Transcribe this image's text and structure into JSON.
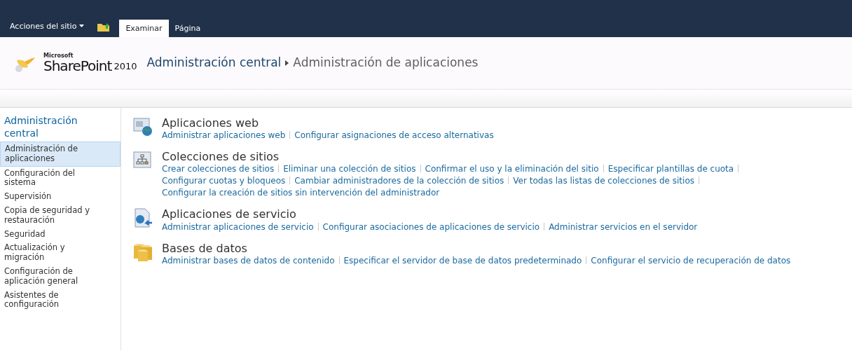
{
  "ribbon": {
    "site_actions": "Acciones del sitio",
    "tabs": [
      {
        "label": "Examinar",
        "selected": true
      },
      {
        "label": "Página",
        "selected": false
      }
    ]
  },
  "header": {
    "logo_small": "Microsoft",
    "logo_product": "SharePoint",
    "logo_version": "2010",
    "breadcrumb": [
      "Administración central",
      "Administración de aplicaciones"
    ]
  },
  "sidebar": {
    "title": "Administración central",
    "items": [
      {
        "label": "Administración de aplicaciones",
        "selected": true
      },
      {
        "label": "Configuración del sistema",
        "selected": false
      },
      {
        "label": "Supervisión",
        "selected": false
      },
      {
        "label": "Copia de seguridad y restauración",
        "selected": false
      },
      {
        "label": "Seguridad",
        "selected": false
      },
      {
        "label": "Actualización y migración",
        "selected": false
      },
      {
        "label": "Configuración de aplicación general",
        "selected": false
      },
      {
        "label": "Asistentes de configuración",
        "selected": false
      }
    ]
  },
  "sections": [
    {
      "kind": "web",
      "title": "Aplicaciones web",
      "link_rows": [
        [
          "Administrar aplicaciones web",
          "Configurar asignaciones de acceso alternativas"
        ]
      ]
    },
    {
      "kind": "sites",
      "title": "Colecciones de sitios",
      "link_rows": [
        [
          "Crear colecciones de sitios",
          "Eliminar una colección de sitios",
          "Confirmar el uso y la eliminación del sitio",
          "Especificar plantillas de cuota"
        ],
        [
          "Configurar cuotas y bloqueos",
          "Cambiar administradores de la colección de sitios",
          "Ver todas las listas de colecciones de sitios"
        ],
        [
          "Configurar la creación de sitios sin intervención del administrador"
        ]
      ]
    },
    {
      "kind": "service",
      "title": "Aplicaciones de servicio",
      "link_rows": [
        [
          "Administrar aplicaciones de servicio",
          "Configurar asociaciones de aplicaciones de servicio",
          "Administrar servicios en el servidor"
        ]
      ]
    },
    {
      "kind": "database",
      "title": "Bases de datos",
      "link_rows": [
        [
          "Administrar bases de datos de contenido",
          "Especificar el servidor de base de datos predeterminado",
          "Configurar el servicio de recuperación de datos"
        ]
      ]
    }
  ]
}
